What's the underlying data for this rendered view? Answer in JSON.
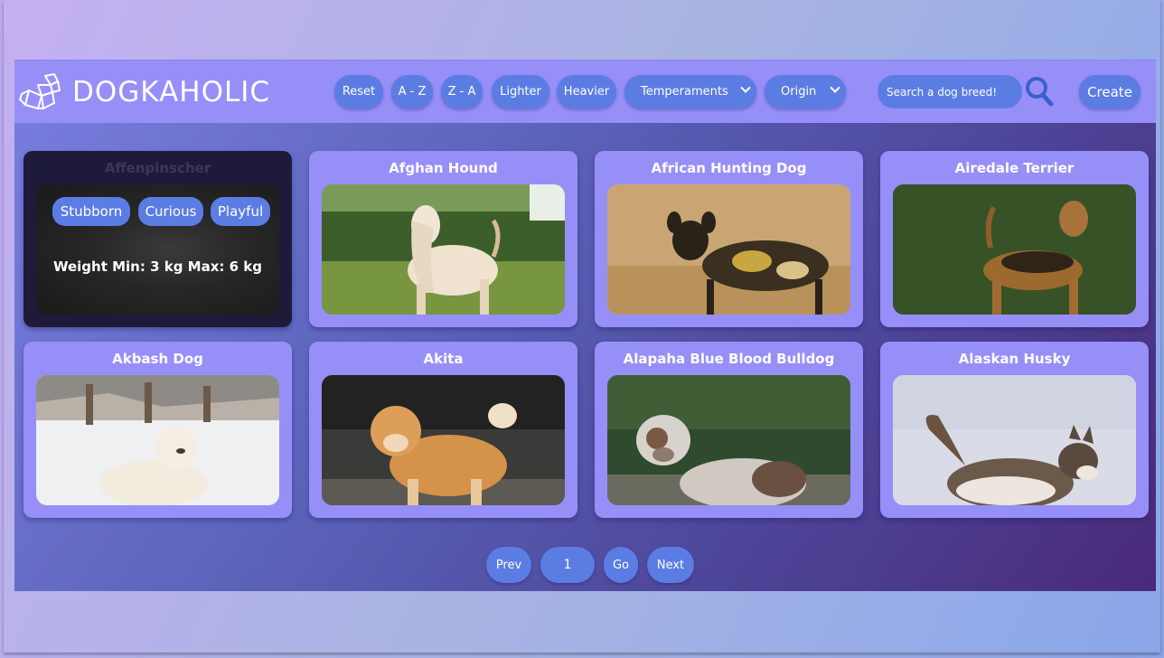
{
  "brand": {
    "name": "DOGKAHOLIC"
  },
  "toolbar": {
    "reset": "Reset",
    "az": "A - Z",
    "za": "Z - A",
    "lighter": "Lighter",
    "heavier": "Heavier",
    "temperaments": "Temperaments",
    "origin": "Origin",
    "search_placeholder": "Search a dog breed!",
    "create": "Create"
  },
  "cards": [
    {
      "name": "Affenpinscher",
      "temperaments": [
        "Stubborn",
        "Curious",
        "Playful"
      ],
      "weight": "Weight Min: 3 kg Max: 6 kg"
    },
    {
      "name": "Afghan Hound"
    },
    {
      "name": "African Hunting Dog"
    },
    {
      "name": "Airedale Terrier"
    },
    {
      "name": "Akbash Dog"
    },
    {
      "name": "Akita"
    },
    {
      "name": "Alapaha Blue Blood Bulldog"
    },
    {
      "name": "Alaskan Husky"
    }
  ],
  "pagination": {
    "prev": "Prev",
    "page": "1",
    "go": "Go",
    "next": "Next"
  },
  "colors": {
    "navbar": "#978ff8",
    "button": "#5b7de3",
    "card": "#978ff8",
    "hover_card": "#1e1b3a"
  }
}
